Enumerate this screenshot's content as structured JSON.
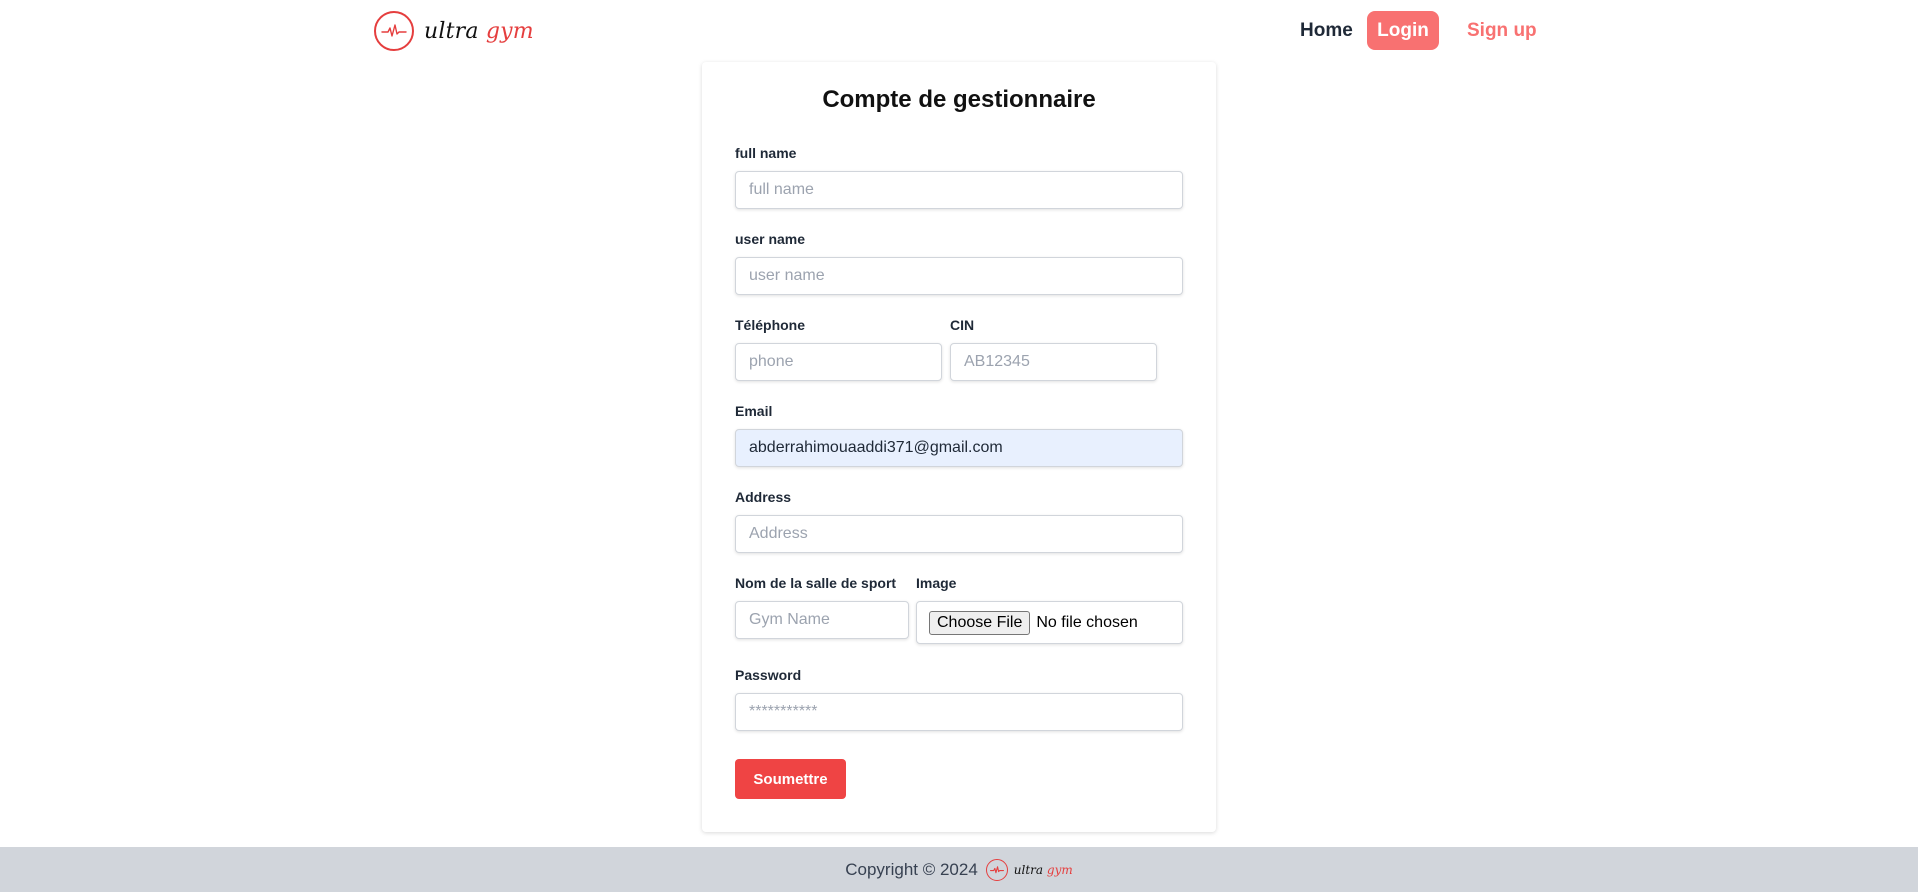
{
  "brand": {
    "name_part1": "ultra",
    "name_part2": "gym",
    "icon": "heartbeat-icon",
    "accent_color": "#e53e3e"
  },
  "nav": {
    "home": "Home",
    "login": "Login",
    "signup": "Sign up"
  },
  "form": {
    "title": "Compte de gestionnaire",
    "full_name": {
      "label": "full name",
      "placeholder": "full name",
      "value": ""
    },
    "user_name": {
      "label": "user name",
      "placeholder": "user name",
      "value": ""
    },
    "telephone": {
      "label": "Téléphone",
      "placeholder": "phone",
      "value": ""
    },
    "cin": {
      "label": "CIN",
      "placeholder": "AB12345",
      "value": ""
    },
    "email": {
      "label": "Email",
      "placeholder": "",
      "value": "abderrahimouaaddi371@gmail.com"
    },
    "address": {
      "label": "Address",
      "placeholder": "Address",
      "value": ""
    },
    "gym_name": {
      "label": "Nom de la salle de sport",
      "placeholder": "Gym Name",
      "value": ""
    },
    "image": {
      "label": "Image",
      "button": "Choose File",
      "status": "No file chosen"
    },
    "password": {
      "label": "Password",
      "placeholder": "***********",
      "value": ""
    },
    "submit": "Soumettre",
    "submit_color": "#ef4444"
  },
  "footer": {
    "copyright": "Copyright © 2024"
  }
}
